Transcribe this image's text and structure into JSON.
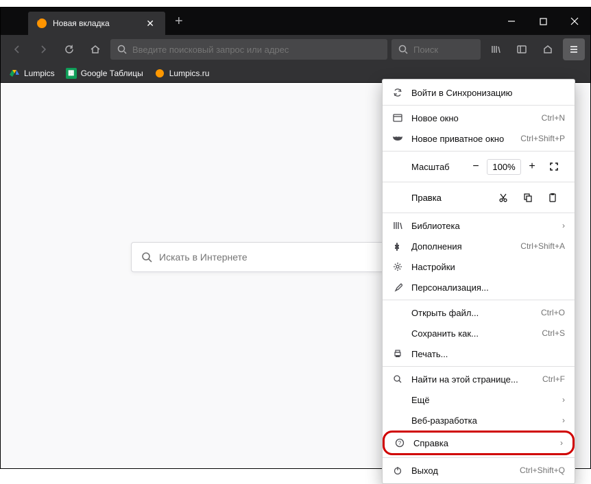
{
  "tab": {
    "title": "Новая вкладка"
  },
  "toolbar": {
    "url_placeholder": "Введите поисковый запрос или адрес",
    "search_placeholder": "Поиск"
  },
  "bookmarks": [
    {
      "label": "Lumpics",
      "color": "#ffc107",
      "kind": "drive"
    },
    {
      "label": "Google Таблицы",
      "color": "#0f9d58",
      "kind": "sheets"
    },
    {
      "label": "Lumpics.ru",
      "color": "#ff9800",
      "kind": "dot"
    }
  ],
  "homesearch": {
    "placeholder": "Искать в Интернете"
  },
  "menu": {
    "sync": "Войти в Синхронизацию",
    "new_window": {
      "label": "Новое окно",
      "shortcut": "Ctrl+N"
    },
    "new_private": {
      "label": "Новое приватное окно",
      "shortcut": "Ctrl+Shift+P"
    },
    "zoom": {
      "label": "Масштаб",
      "value": "100%"
    },
    "edit": {
      "label": "Правка"
    },
    "library": "Библиотека",
    "addons": {
      "label": "Дополнения",
      "shortcut": "Ctrl+Shift+A"
    },
    "settings": "Настройки",
    "customize": "Персонализация...",
    "open_file": {
      "label": "Открыть файл...",
      "shortcut": "Ctrl+O"
    },
    "save_as": {
      "label": "Сохранить как...",
      "shortcut": "Ctrl+S"
    },
    "print": "Печать...",
    "find": {
      "label": "Найти на этой странице...",
      "shortcut": "Ctrl+F"
    },
    "more": "Ещё",
    "webdev": "Веб-разработка",
    "help": "Справка",
    "quit": {
      "label": "Выход",
      "shortcut": "Ctrl+Shift+Q"
    }
  }
}
